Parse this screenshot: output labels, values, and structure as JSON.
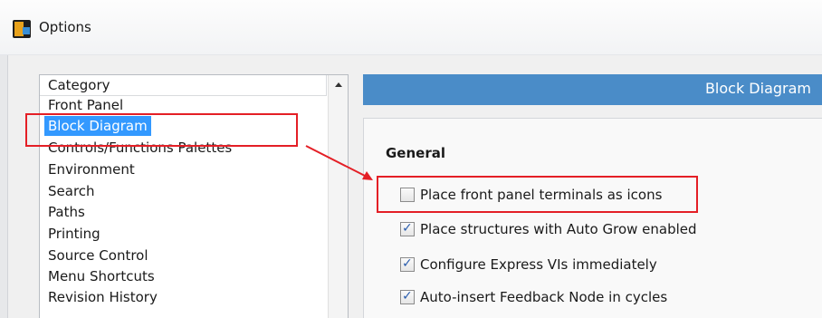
{
  "window": {
    "title": "Options",
    "icon": "labview-app-icon"
  },
  "category": {
    "header": "Category",
    "items": [
      "Front Panel",
      "Block Diagram",
      "Controls/Functions Palettes",
      "Environment",
      "Search",
      "Paths",
      "Printing",
      "Source Control",
      "Menu Shortcuts",
      "Revision History"
    ],
    "selected_index": 1
  },
  "panel": {
    "title": "Block Diagram",
    "section": "General",
    "options": [
      {
        "label": "Place front panel terminals as icons",
        "checked": false
      },
      {
        "label": "Place structures with Auto Grow enabled",
        "checked": true
      },
      {
        "label": "Configure Express VIs immediately",
        "checked": true
      },
      {
        "label": "Auto-insert Feedback Node in cycles",
        "checked": true
      }
    ]
  },
  "colors": {
    "banner": "#4a8cc8",
    "selection": "#3399ff",
    "highlight": "#e41f26",
    "checkmark": "#2a5dad"
  }
}
